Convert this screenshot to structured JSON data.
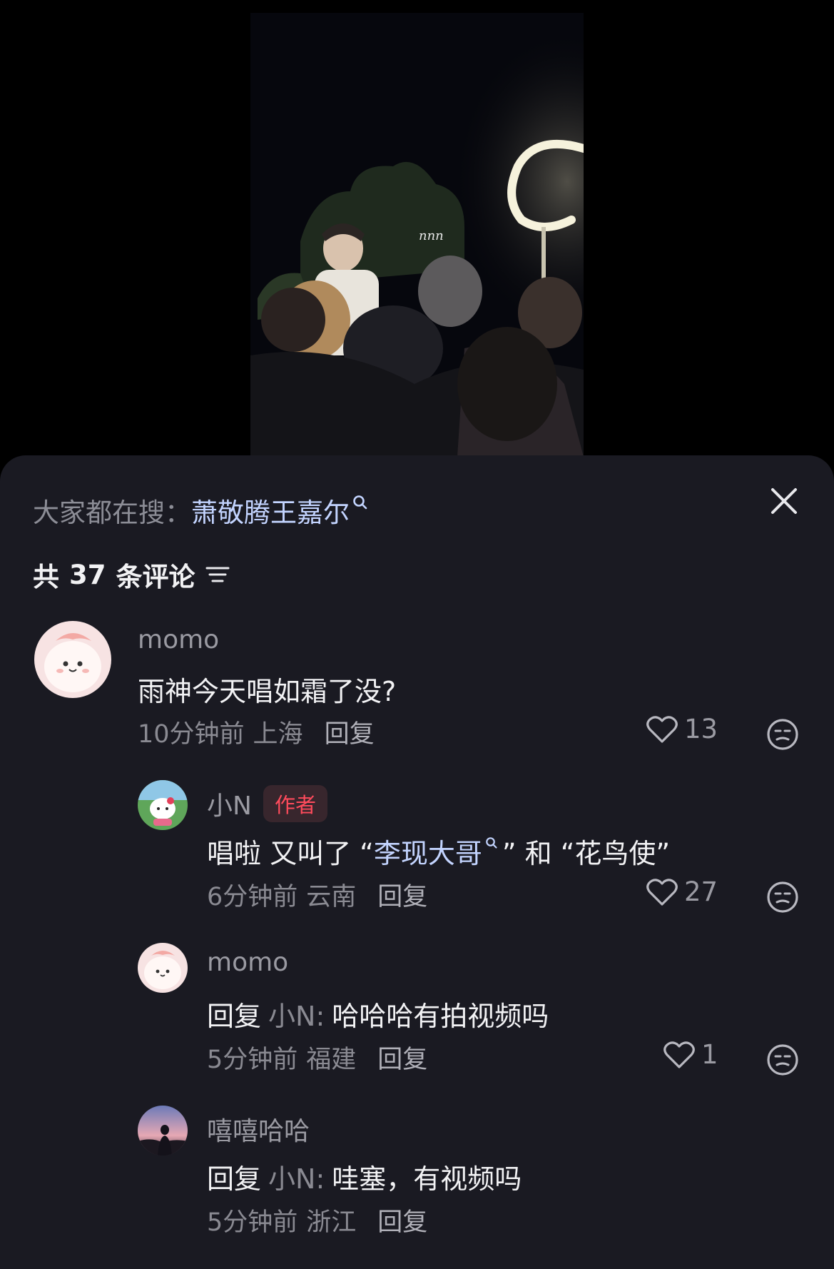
{
  "search": {
    "prefix": "大家都在搜：",
    "term": "萧敬腾王嘉尔"
  },
  "video": {
    "watermark": "nnn"
  },
  "comments_header": {
    "prefix": "共",
    "count": "37",
    "suffix": "条评论"
  },
  "comments": [
    {
      "user": "momo",
      "text": "雨神今天唱如霜了没?",
      "time": "10分钟前",
      "location": "上海",
      "reply_label": "回复",
      "likes": "13"
    }
  ],
  "replies": [
    {
      "user": "小N",
      "badge": "作者",
      "text_a": "唱啦 又叫了 “",
      "link": "李现大哥",
      "text_b": "” 和 “花鸟使”",
      "time": "6分钟前",
      "location": "云南",
      "reply_label": "回复",
      "likes": "27"
    },
    {
      "user": "momo",
      "reply_prefix": "回复",
      "reply_to": "小N:",
      "text": "哈哈哈有拍视频吗",
      "time": "5分钟前",
      "location": "福建",
      "reply_label": "回复",
      "likes": "1"
    },
    {
      "user": "嘻嘻哈哈",
      "reply_prefix": "回复",
      "reply_to": "小N:",
      "text": "哇塞，有视频吗",
      "time": "5分钟前",
      "location": "浙江",
      "reply_label": "回复"
    }
  ],
  "colors": {
    "sheet_bg": "#1a1a22",
    "link": "#c3d4ff",
    "badge": "#ff4b5c"
  }
}
